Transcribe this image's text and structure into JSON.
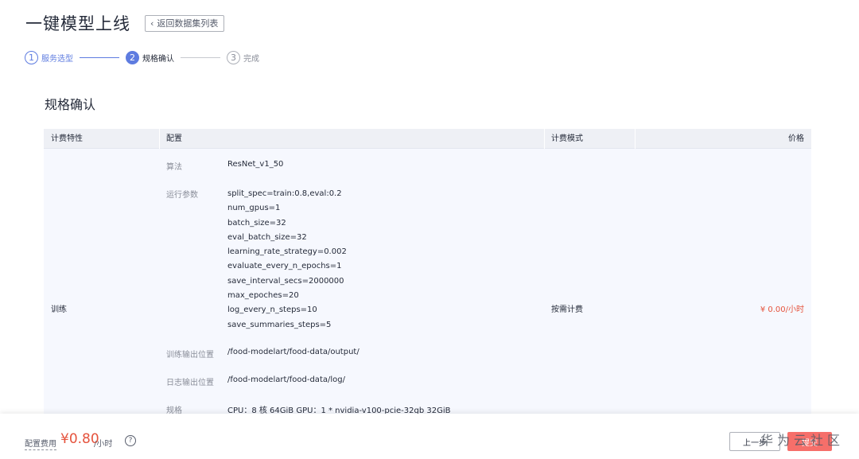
{
  "header": {
    "title": "一键模型上线",
    "back_label": "返回数据集列表"
  },
  "steps": [
    {
      "num": "1",
      "label": "服务选型",
      "state": "done"
    },
    {
      "num": "2",
      "label": "规格确认",
      "state": "active"
    },
    {
      "num": "3",
      "label": "完成",
      "state": "pending"
    }
  ],
  "section_title": "规格确认",
  "table": {
    "headers": {
      "feature": "计费特性",
      "config": "配置",
      "mode": "计费模式",
      "price": "价格"
    },
    "row": {
      "feature": "训练",
      "mode": "按需计费",
      "price": "¥ 0.00/小时",
      "config": {
        "algorithm_label": "算法",
        "algorithm_value": "ResNet_v1_50",
        "params_label": "运行参数",
        "params": [
          "split_spec=train:0.8,eval:0.2",
          "num_gpus=1",
          "batch_size=32",
          "eval_batch_size=32",
          "learning_rate_strategy=0.002",
          "evaluate_every_n_epochs=1",
          "save_interval_secs=2000000",
          "max_epoches=20",
          "log_every_n_steps=10",
          "save_summaries_steps=5"
        ],
        "output_label": "训练输出位置",
        "output_value": "/food-modelart/food-data/output/",
        "log_label": "日志输出位置",
        "log_value": "/food-modelart/food-data/log/",
        "spec_label": "规格",
        "spec_value": "CPU：8 核 64GiB GPU：1 * nvidia-v100-pcie-32gb 32GiB"
      }
    }
  },
  "footer": {
    "fee_label": "配置费用",
    "fee_amount": "¥0.80",
    "fee_unit": "/小时",
    "help_icon": "?",
    "prev_label": "上一步",
    "submit_label": "提交",
    "watermark": "华为云社区"
  },
  "colors": {
    "accent": "#5e7ce0",
    "price_red": "#e5533d",
    "submit_bg": "#f66f6a",
    "table_bg": "#f6f8fe"
  }
}
